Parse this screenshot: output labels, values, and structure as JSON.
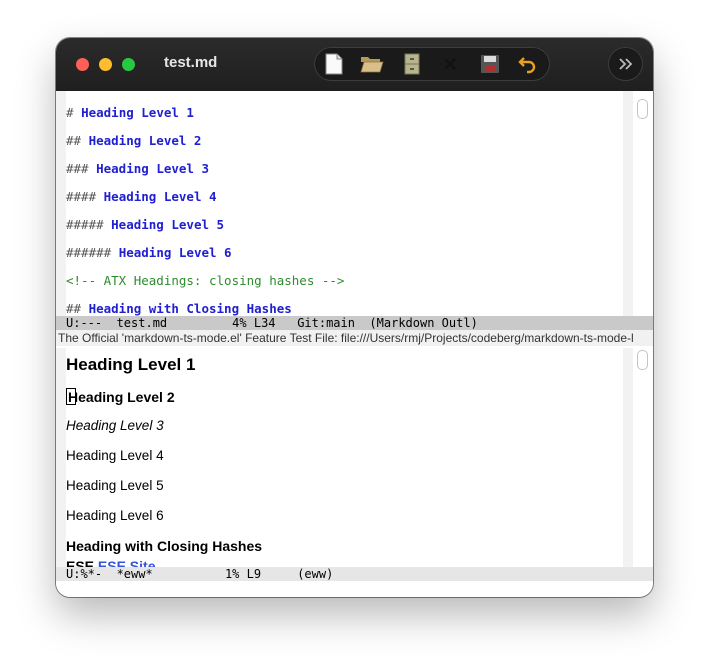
{
  "window": {
    "title": "test.md"
  },
  "toolbar": {
    "icons": [
      "new-file-icon",
      "open-folder-icon",
      "file-cabinet-icon",
      "close-icon",
      "save-icon",
      "undo-icon"
    ],
    "more_icon": "chevron-double-right-icon"
  },
  "top_pane": {
    "lines": [
      {
        "prefix": "# ",
        "text": "Heading Level 1"
      },
      {
        "prefix": "## ",
        "text": "Heading Level 2"
      },
      {
        "prefix": "### ",
        "text": "Heading Level 3"
      },
      {
        "prefix": "#### ",
        "text": "Heading Level 4"
      },
      {
        "prefix": "##### ",
        "text": "Heading Level 5"
      },
      {
        "prefix": "###### ",
        "text": "Heading Level 6"
      },
      {
        "comment": "<!-- ATX Headings: closing hashes -->"
      },
      {
        "prefix": "## ",
        "text": "Heading with Closing Hashes"
      }
    ],
    "modeline": "U:---  test.md         4% L34   Git:main  (Markdown Outl)"
  },
  "header_line": "The Official 'markdown-ts-mode.el' Feature Test File:  file:///Users/rmj/Projects/codeberg/markdown-ts-mode-l",
  "bottom_pane": {
    "h1": "Heading Level 1",
    "h2_first": "H",
    "h2_rest": "eading Level 2",
    "h3": "Heading Level 3",
    "h4": "Heading Level 4",
    "h5": "Heading Level 5",
    "h6": "Heading Level 6",
    "closing": "Heading with Closing Hashes",
    "partial_plain": "ESE",
    "partial_link": "ESE Site",
    "modeline": "U:%*-  *eww*          1% L9     (eww)"
  }
}
